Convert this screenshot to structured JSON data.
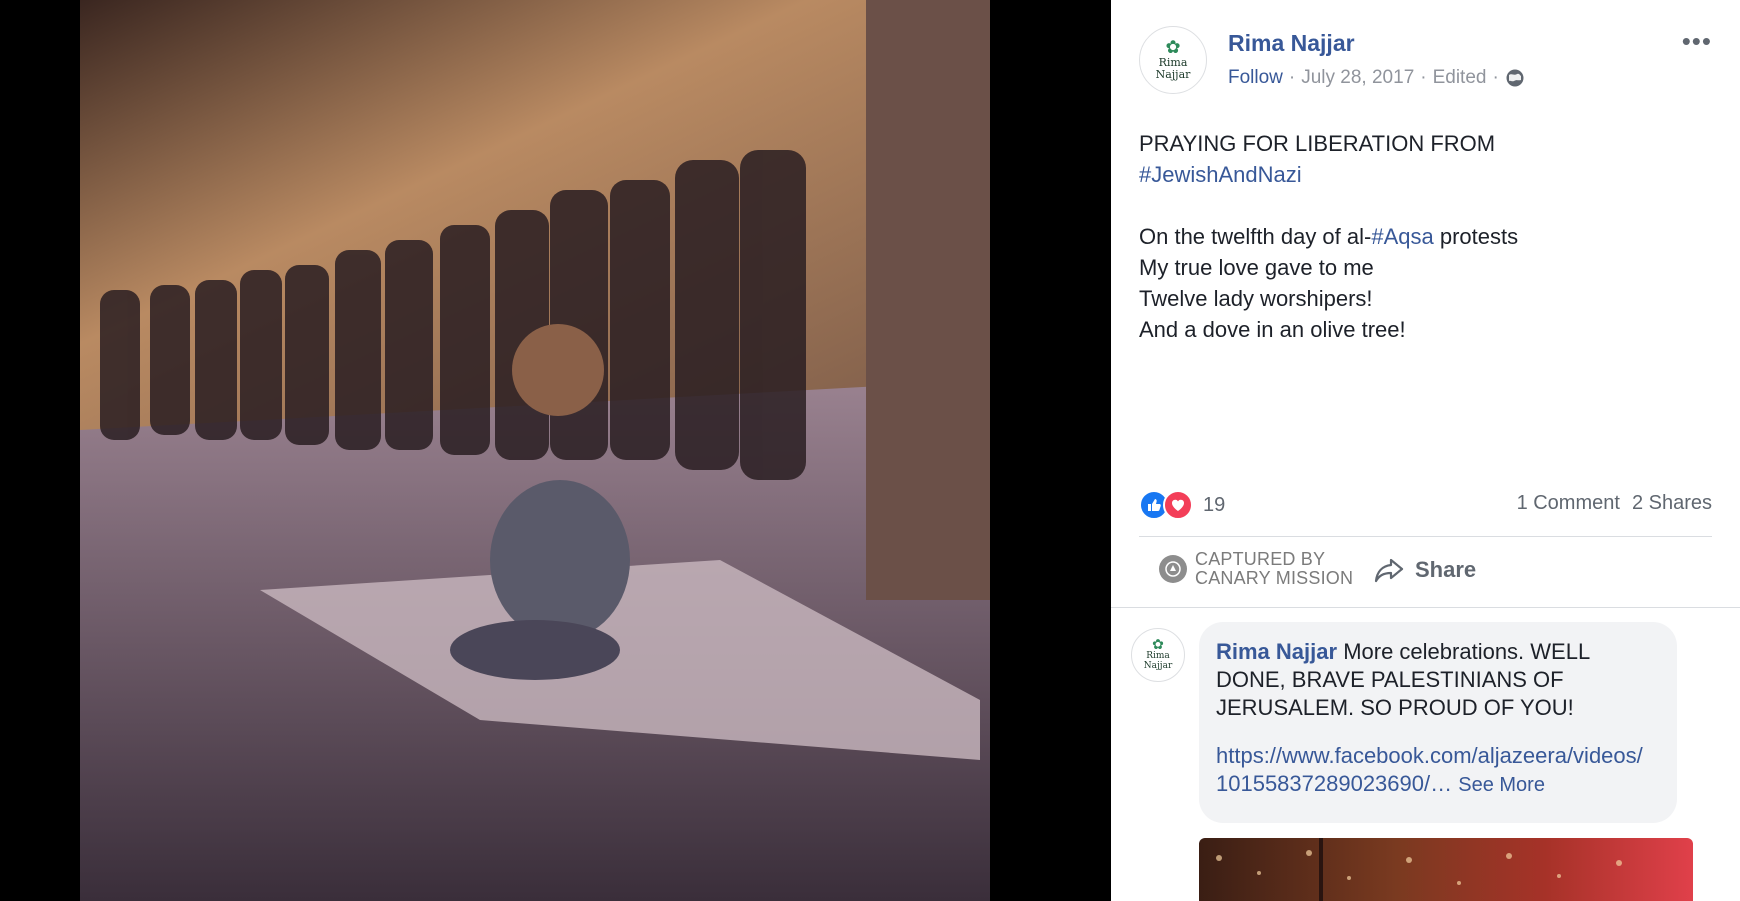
{
  "post": {
    "author": "Rima Najjar",
    "follow": "Follow",
    "date": "July 28, 2017",
    "edited": "Edited",
    "dot": "·",
    "more": "•••",
    "avatar_text": "Rima Najjar",
    "line1": "PRAYING FOR LIBERATION FROM",
    "hashtag1": "#JewishAndNazi",
    "line2_a": "On the twelfth day of al-",
    "hashtag2": "#Aqsa",
    "line2_b": " protests",
    "line3": "My true love gave to me",
    "line4": "Twelve lady worshipers!",
    "line5": "And a dove in an olive tree!"
  },
  "engagement": {
    "reactions_count": "19",
    "comments": "1 Comment",
    "shares": "2 Shares"
  },
  "actions": {
    "captured_line1": "CAPTURED BY",
    "captured_line2": "CANARY MISSION",
    "share_label": "Share"
  },
  "comment": {
    "author": "Rima Najjar",
    "avatar_text": "Rima Najjar",
    "text": "More celebrations. WELL DONE, BRAVE PALESTINIANS OF JERUSALEM. SO PROUD OF YOU!",
    "link_line1": "https://www.facebook.com/aljazeera/videos/",
    "link_line2": "10155837289023690/…",
    "see_more": "See More"
  },
  "colors": {
    "link_blue": "#385898",
    "like_blue": "#1877f2",
    "love_red": "#f33e58"
  }
}
